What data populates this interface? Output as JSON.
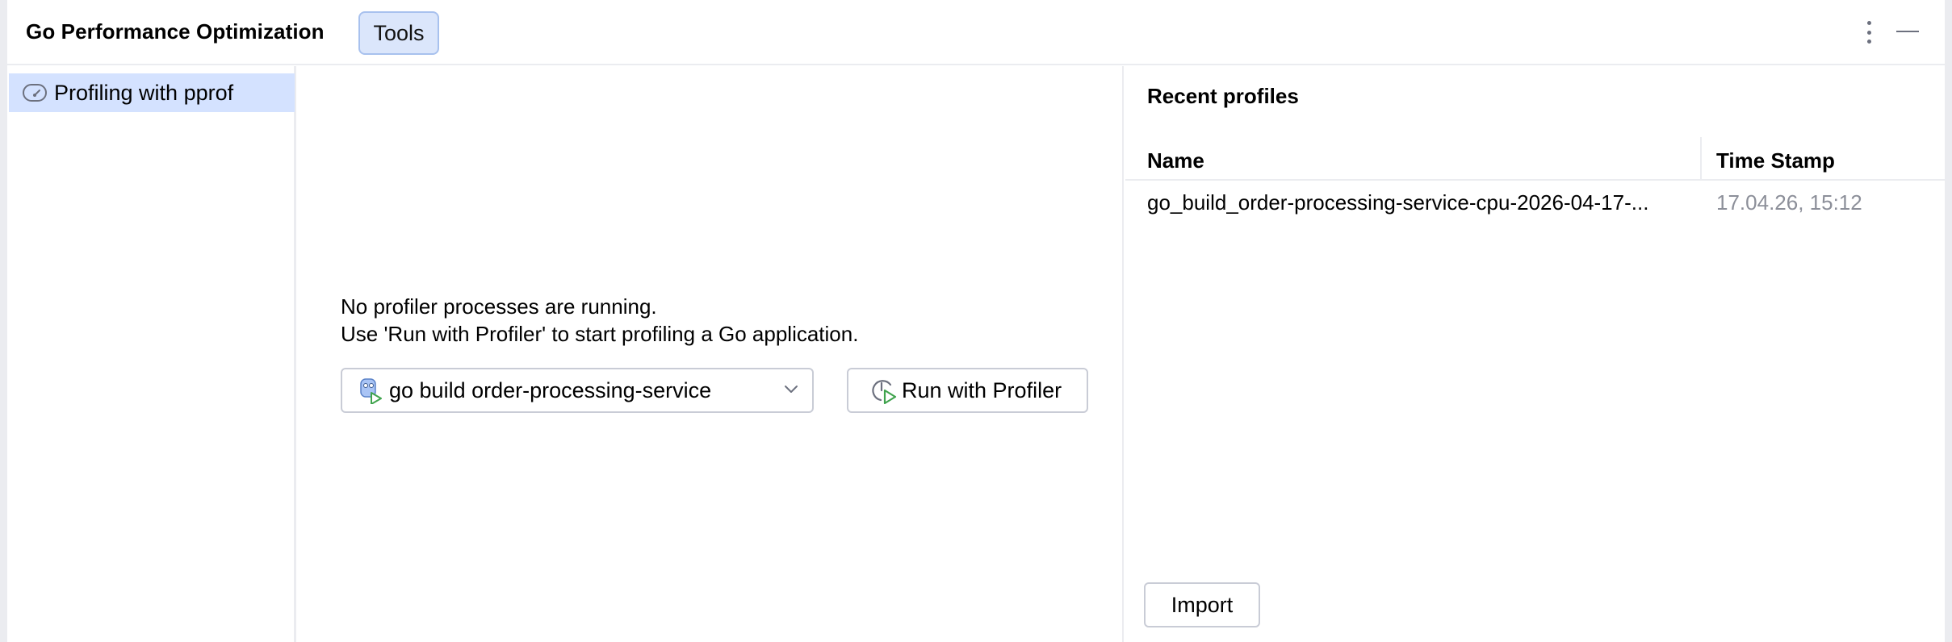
{
  "header": {
    "title": "Go Performance Optimization",
    "tools_label": "Tools",
    "more_icon": "more-vertical-icon",
    "minimize_icon": "minimize-icon"
  },
  "sidebar": {
    "items": [
      {
        "label": "Profiling with pprof",
        "icon": "gauge-icon",
        "selected": true
      }
    ]
  },
  "center": {
    "message_line1": "No profiler processes are running.",
    "message_line2": "Use 'Run with Profiler' to start profiling a Go application.",
    "config_select": {
      "value": "go build order-processing-service",
      "icon": "go-run-config-icon"
    },
    "run_button": {
      "label": "Run with Profiler",
      "icon": "profiler-run-icon"
    }
  },
  "recent": {
    "title": "Recent profiles",
    "columns": [
      "Name",
      "Time Stamp"
    ],
    "rows": [
      {
        "name": "go_build_order-processing-service-cpu-2026-04-17-...",
        "time": "17.04.26, 15:12"
      }
    ],
    "import_label": "Import"
  },
  "colors": {
    "accent_selected": "#d4e2ff",
    "tools_bg": "#dbe6fb",
    "tools_border": "#a8c1ee",
    "muted_text": "#8c8f99"
  }
}
